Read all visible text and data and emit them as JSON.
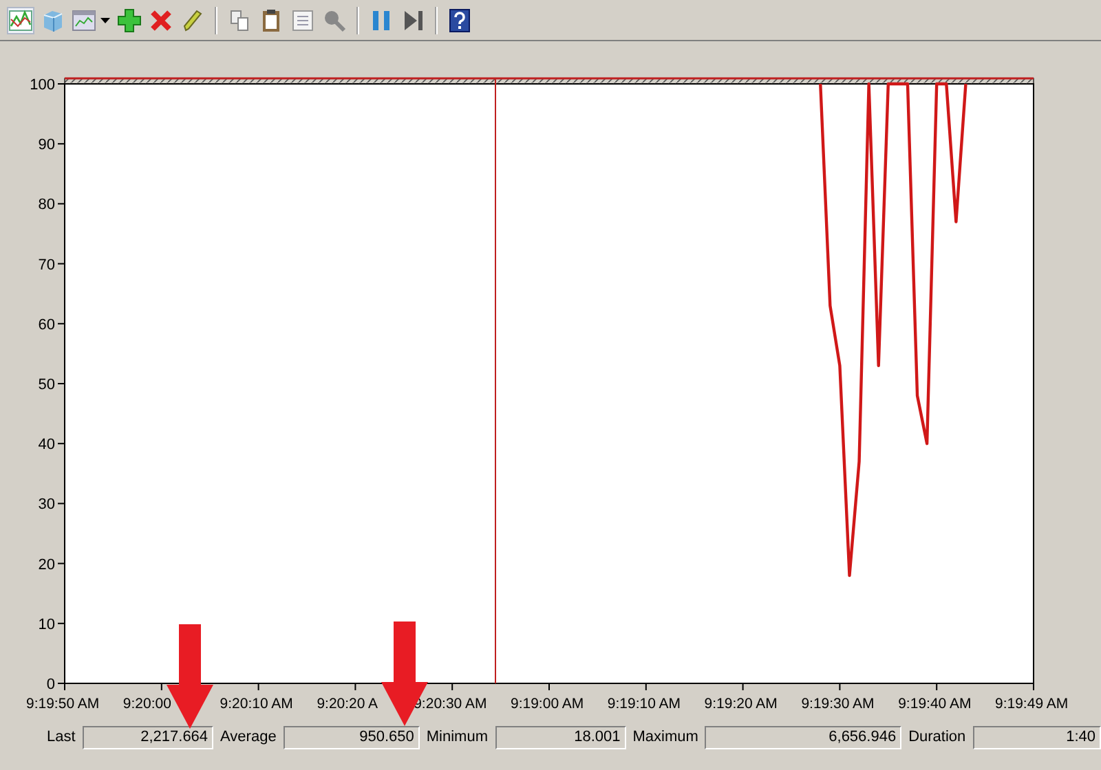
{
  "toolbar": {
    "buttons": [
      {
        "kind": "graph"
      },
      {
        "kind": "cube"
      },
      {
        "kind": "report"
      },
      {
        "kind": "dropdown"
      },
      {
        "kind": "add"
      },
      {
        "kind": "delete"
      },
      {
        "kind": "highlight"
      },
      {
        "kind": "sep"
      },
      {
        "kind": "copy"
      },
      {
        "kind": "paste"
      },
      {
        "kind": "properties"
      },
      {
        "kind": "zoom"
      },
      {
        "kind": "sep"
      },
      {
        "kind": "pause"
      },
      {
        "kind": "step"
      },
      {
        "kind": "sep"
      },
      {
        "kind": "help"
      }
    ]
  },
  "chart": {
    "chart_data": {
      "type": "line",
      "ylim": [
        0,
        100
      ],
      "yticks": [
        0,
        10,
        20,
        30,
        40,
        50,
        60,
        70,
        80,
        90,
        100
      ],
      "categories": [
        "9:19:50 AM",
        null,
        null,
        null,
        null,
        null,
        null,
        null,
        null,
        null,
        "9:20:00",
        null,
        null,
        null,
        null,
        null,
        null,
        null,
        null,
        null,
        "9:20:10 AM",
        null,
        null,
        null,
        null,
        null,
        null,
        null,
        null,
        null,
        "9:20:20 A",
        null,
        null,
        null,
        null,
        null,
        null,
        null,
        null,
        null,
        "9:20:30 AM",
        null,
        null,
        null,
        null,
        null,
        null,
        null,
        null,
        null,
        "9:19:00 AM",
        null,
        null,
        null,
        null,
        null,
        null,
        null,
        null,
        null,
        "9:19:10 AM",
        null,
        null,
        null,
        null,
        null,
        null,
        null,
        null,
        null,
        "9:19:20 AM",
        null,
        null,
        null,
        null,
        null,
        null,
        null,
        null,
        null,
        "9:19:30 AM",
        null,
        null,
        null,
        null,
        null,
        null,
        null,
        null,
        null,
        "9:19:40 AM",
        null,
        null,
        null,
        null,
        null,
        null,
        null,
        null,
        null,
        "9:19:49 AM"
      ],
      "series": [
        {
          "color": "#d01818",
          "values": [
            null,
            null,
            null,
            null,
            null,
            null,
            null,
            null,
            null,
            null,
            null,
            null,
            null,
            null,
            null,
            null,
            null,
            null,
            null,
            null,
            null,
            null,
            null,
            null,
            null,
            null,
            null,
            null,
            null,
            null,
            null,
            null,
            null,
            null,
            null,
            null,
            null,
            null,
            null,
            null,
            null,
            null,
            null,
            null,
            null,
            null,
            null,
            null,
            null,
            null,
            null,
            null,
            null,
            null,
            null,
            null,
            null,
            null,
            null,
            null,
            null,
            null,
            null,
            null,
            null,
            null,
            null,
            null,
            null,
            null,
            null,
            null,
            null,
            null,
            null,
            null,
            null,
            null,
            100,
            63,
            53,
            18,
            37,
            100,
            53,
            100,
            100,
            100,
            48,
            40,
            100,
            100,
            77,
            100,
            null,
            null,
            null,
            null,
            null,
            null,
            null
          ]
        }
      ]
    }
  },
  "stats": [
    {
      "label": "Last",
      "value": "2,217.664"
    },
    {
      "label": "Average",
      "value": "950.650"
    },
    {
      "label": "Minimum",
      "value": "18.001"
    },
    {
      "label": "Maximum",
      "value": "6,656.946"
    },
    {
      "label": "Duration",
      "value": "1:40"
    }
  ]
}
